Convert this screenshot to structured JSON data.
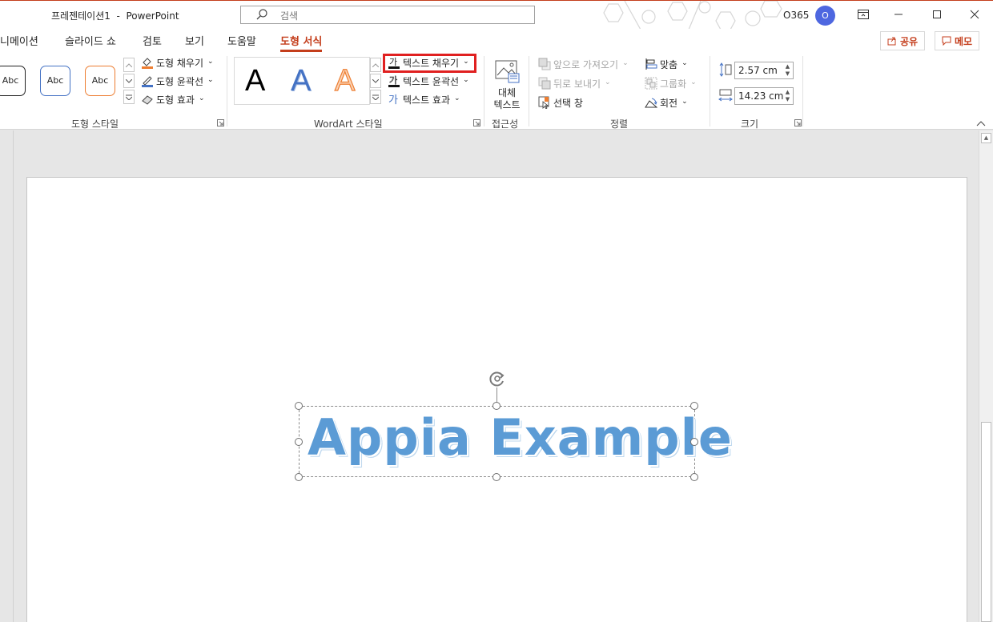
{
  "titlebar": {
    "title": "프레젠테이션1  -  PowerPoint",
    "search_placeholder": "검색",
    "account_label": "O365",
    "avatar_initial": "O"
  },
  "tabs": [
    {
      "label": "니메이션"
    },
    {
      "label": "슬라이드 쇼"
    },
    {
      "label": "검토"
    },
    {
      "label": "보기"
    },
    {
      "label": "도움말"
    },
    {
      "label": "도형 서식",
      "active": true
    }
  ],
  "top_buttons": {
    "share": "공유",
    "comments": "메모"
  },
  "ribbon": {
    "shape_styles": {
      "abc": [
        "Abc",
        "Abc",
        "Abc"
      ],
      "fill": "도형 채우기",
      "outline": "도형 윤곽선",
      "effects": "도형 효과",
      "group_label": "도형 스타일"
    },
    "wordart": {
      "letters": [
        "A",
        "A",
        "A"
      ],
      "text_fill": "텍스트 채우기",
      "text_outline": "텍스트 윤곽선",
      "text_effects": "텍스트 효과",
      "group_label": "WordArt 스타일"
    },
    "accessibility": {
      "alt_text_line1": "대체",
      "alt_text_line2": "텍스트",
      "group_label": "접근성"
    },
    "arrange": {
      "bring_forward": "앞으로 가져오기",
      "send_backward": "뒤로 보내기",
      "selection_pane": "선택 창",
      "align": "맞춤",
      "group": "그룹화",
      "rotate": "회전",
      "group_label": "정렬"
    },
    "size": {
      "height": "2.57 cm",
      "width": "14.23 cm",
      "group_label": "크기"
    }
  },
  "slide": {
    "text": "Appia Example"
  },
  "colors": {
    "accent": "#c43e1c",
    "highlight": "#e02020",
    "text_blue": "#5b9bd5"
  }
}
